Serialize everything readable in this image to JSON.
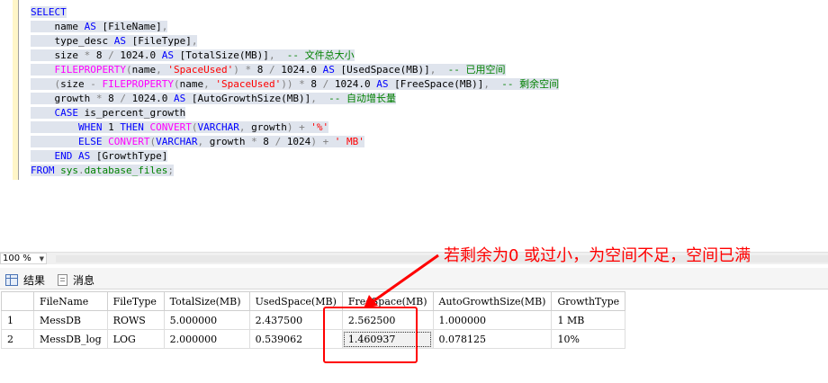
{
  "editor": {
    "lines": [
      [
        {
          "t": "SELECT",
          "c": "kw"
        }
      ],
      [
        {
          "t": "    name ",
          "c": "id"
        },
        {
          "t": "AS",
          "c": "kw"
        },
        {
          "t": " [FileName]",
          "c": "id"
        },
        {
          "t": ",",
          "c": "gray"
        }
      ],
      [
        {
          "t": "    type_desc ",
          "c": "id"
        },
        {
          "t": "AS",
          "c": "kw"
        },
        {
          "t": " [FileType]",
          "c": "id"
        },
        {
          "t": ",",
          "c": "gray"
        }
      ],
      [
        {
          "t": "    size ",
          "c": "id"
        },
        {
          "t": "*",
          "c": "gray"
        },
        {
          "t": " 8 ",
          "c": "id"
        },
        {
          "t": "/",
          "c": "gray"
        },
        {
          "t": " 1024.0 ",
          "c": "id"
        },
        {
          "t": "AS",
          "c": "kw"
        },
        {
          "t": " [TotalSize(MB)]",
          "c": "id"
        },
        {
          "t": ",",
          "c": "gray"
        },
        {
          "t": "  -- 文件总大小",
          "c": "cmt"
        }
      ],
      [
        {
          "t": "    ",
          "c": "id"
        },
        {
          "t": "FILEPROPERTY",
          "c": "fn"
        },
        {
          "t": "(",
          "c": "gray"
        },
        {
          "t": "name",
          "c": "id"
        },
        {
          "t": ",",
          "c": "gray"
        },
        {
          "t": " 'SpaceUsed'",
          "c": "str"
        },
        {
          "t": ")",
          "c": "gray"
        },
        {
          "t": " ",
          "c": "id"
        },
        {
          "t": "*",
          "c": "gray"
        },
        {
          "t": " 8 ",
          "c": "id"
        },
        {
          "t": "/",
          "c": "gray"
        },
        {
          "t": " 1024.0 ",
          "c": "id"
        },
        {
          "t": "AS",
          "c": "kw"
        },
        {
          "t": " [UsedSpace(MB)]",
          "c": "id"
        },
        {
          "t": ",",
          "c": "gray"
        },
        {
          "t": "  -- 已用空间",
          "c": "cmt"
        }
      ],
      [
        {
          "t": "    ",
          "c": "id"
        },
        {
          "t": "(",
          "c": "gray"
        },
        {
          "t": "size ",
          "c": "id"
        },
        {
          "t": "-",
          "c": "gray"
        },
        {
          "t": " ",
          "c": "id"
        },
        {
          "t": "FILEPROPERTY",
          "c": "fn"
        },
        {
          "t": "(",
          "c": "gray"
        },
        {
          "t": "name",
          "c": "id"
        },
        {
          "t": ",",
          "c": "gray"
        },
        {
          "t": " 'SpaceUsed'",
          "c": "str"
        },
        {
          "t": "))",
          "c": "gray"
        },
        {
          "t": " ",
          "c": "id"
        },
        {
          "t": "*",
          "c": "gray"
        },
        {
          "t": " 8 ",
          "c": "id"
        },
        {
          "t": "/",
          "c": "gray"
        },
        {
          "t": " 1024.0 ",
          "c": "id"
        },
        {
          "t": "AS",
          "c": "kw"
        },
        {
          "t": " [FreeSpace(MB)]",
          "c": "id"
        },
        {
          "t": ",",
          "c": "gray"
        },
        {
          "t": "  -- 剩余空间",
          "c": "cmt"
        }
      ],
      [
        {
          "t": "    growth ",
          "c": "id"
        },
        {
          "t": "*",
          "c": "gray"
        },
        {
          "t": " 8 ",
          "c": "id"
        },
        {
          "t": "/",
          "c": "gray"
        },
        {
          "t": " 1024.0 ",
          "c": "id"
        },
        {
          "t": "AS",
          "c": "kw"
        },
        {
          "t": " [AutoGrowthSize(MB)]",
          "c": "id"
        },
        {
          "t": ",",
          "c": "gray"
        },
        {
          "t": "  -- 自动增长量",
          "c": "cmt"
        }
      ],
      [
        {
          "t": "    ",
          "c": "id"
        },
        {
          "t": "CASE",
          "c": "kw"
        },
        {
          "t": " is_percent_growth",
          "c": "id"
        }
      ],
      [
        {
          "t": "        ",
          "c": "id"
        },
        {
          "t": "WHEN",
          "c": "kw"
        },
        {
          "t": " 1 ",
          "c": "id"
        },
        {
          "t": "THEN",
          "c": "kw"
        },
        {
          "t": " ",
          "c": "id"
        },
        {
          "t": "CONVERT",
          "c": "fn"
        },
        {
          "t": "(",
          "c": "gray"
        },
        {
          "t": "VARCHAR",
          "c": "kw"
        },
        {
          "t": ",",
          "c": "gray"
        },
        {
          "t": " growth",
          "c": "id"
        },
        {
          "t": ")",
          "c": "gray"
        },
        {
          "t": " ",
          "c": "id"
        },
        {
          "t": "+",
          "c": "gray"
        },
        {
          "t": " '%'",
          "c": "str"
        }
      ],
      [
        {
          "t": "        ",
          "c": "id"
        },
        {
          "t": "ELSE",
          "c": "kw"
        },
        {
          "t": " ",
          "c": "id"
        },
        {
          "t": "CONVERT",
          "c": "fn"
        },
        {
          "t": "(",
          "c": "gray"
        },
        {
          "t": "VARCHAR",
          "c": "kw"
        },
        {
          "t": ",",
          "c": "gray"
        },
        {
          "t": " growth ",
          "c": "id"
        },
        {
          "t": "*",
          "c": "gray"
        },
        {
          "t": " 8 ",
          "c": "id"
        },
        {
          "t": "/",
          "c": "gray"
        },
        {
          "t": " 1024",
          "c": "id"
        },
        {
          "t": ")",
          "c": "gray"
        },
        {
          "t": " ",
          "c": "id"
        },
        {
          "t": "+",
          "c": "gray"
        },
        {
          "t": " ' MB'",
          "c": "str"
        }
      ],
      [
        {
          "t": "    ",
          "c": "id"
        },
        {
          "t": "END",
          "c": "kw"
        },
        {
          "t": " ",
          "c": "id"
        },
        {
          "t": "AS",
          "c": "kw"
        },
        {
          "t": " [GrowthType]",
          "c": "id"
        }
      ],
      [
        {
          "t": "FROM",
          "c": "kw"
        },
        {
          "t": " sys",
          "c": "sys"
        },
        {
          "t": ".",
          "c": "gray"
        },
        {
          "t": "database_files",
          "c": "sys"
        },
        {
          "t": ";",
          "c": "gray"
        }
      ]
    ]
  },
  "zoom": {
    "value": "100 %"
  },
  "tabs": {
    "results": "结果",
    "messages": "消息"
  },
  "grid": {
    "columns": [
      "",
      "FileName",
      "FileType",
      "TotalSize(MB)",
      "UsedSpace(MB)",
      "FreeSpace(MB)",
      "AutoGrowthSize(MB)",
      "GrowthType"
    ],
    "rows": [
      [
        "1",
        "MessDB",
        "ROWS",
        "5.000000",
        "2.437500",
        "2.562500",
        "1.000000",
        "1 MB"
      ],
      [
        "2",
        "MessDB_log",
        "LOG",
        "2.000000",
        "0.539062",
        "1.460937",
        "0.078125",
        "10%"
      ]
    ]
  },
  "annotation": {
    "text": "若剩余为0 或过小，为空间不足，空间已满",
    "color": "#ff0000"
  }
}
